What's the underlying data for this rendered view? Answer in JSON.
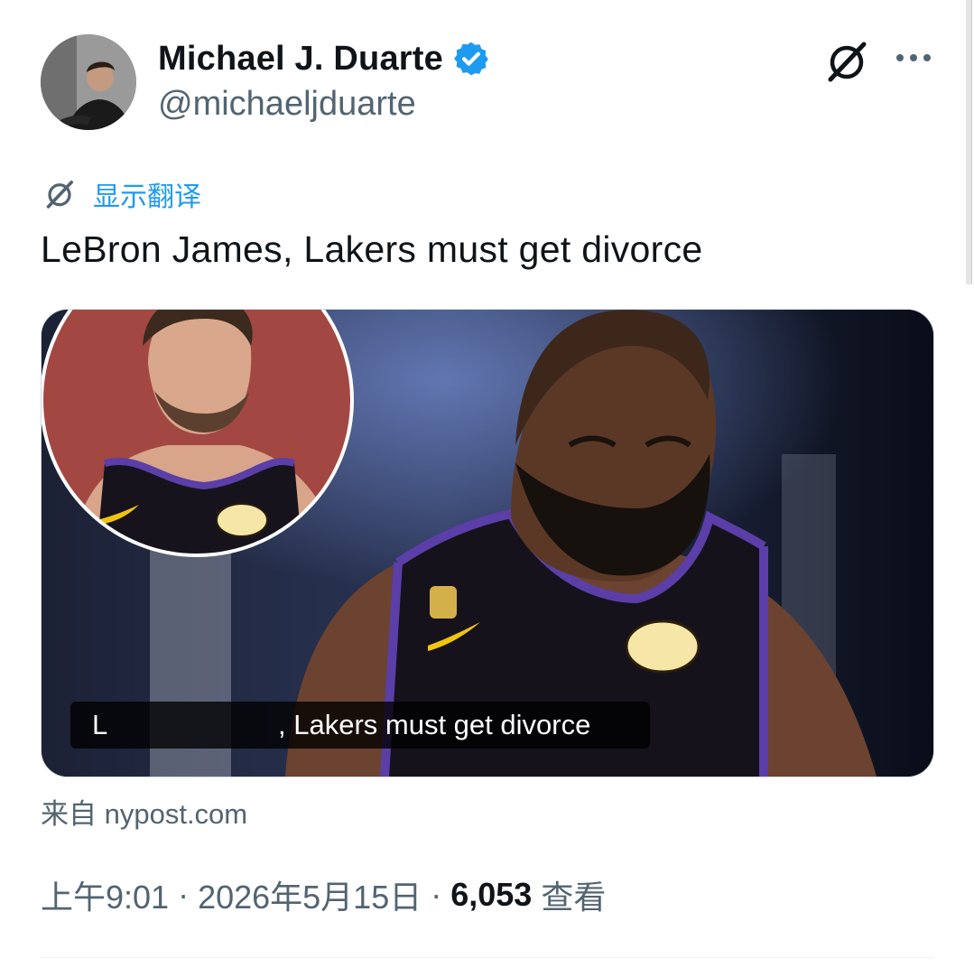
{
  "author": {
    "display_name": "Michael J. Duarte",
    "handle": "@michaeljduarte",
    "verified": true,
    "verified_color": "#1d9bf0"
  },
  "icons": {
    "avatar": "profile-photo",
    "grok": "grok-icon",
    "more": "more-horizontal-icon",
    "translate": "translate-icon",
    "verified": "verified-badge-icon"
  },
  "translate": {
    "label": "显示翻译",
    "color": "#1d9bf0"
  },
  "tweet": {
    "text": "LeBron James, Lakers must get divorce"
  },
  "card": {
    "caption_lead": "L",
    "caption_text": ", Lakers must get divorce",
    "source": "来自 nypost.com"
  },
  "meta": {
    "time": "上午9:01",
    "separator": "·",
    "date": "2026年5月15日",
    "views_count": "6,053",
    "views_label": "查看"
  }
}
